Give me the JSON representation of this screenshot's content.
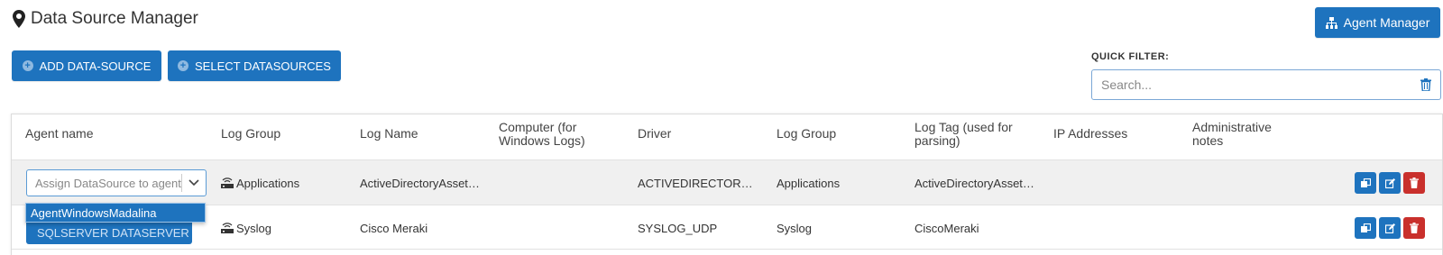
{
  "header": {
    "title": "Data Source Manager",
    "agent_manager_label": "Agent Manager"
  },
  "toolbar": {
    "add_label": "ADD DATA-SOURCE",
    "select_label": "SELECT DATASOURCES"
  },
  "filter": {
    "label": "QUICK FILTER:",
    "placeholder": "Search..."
  },
  "table": {
    "columns": [
      "Agent name",
      "Log Group",
      "Log Name",
      "Computer (for Windows Logs)",
      "Driver",
      "Log Group",
      "Log Tag (used for parsing)",
      "IP Addresses",
      "Administrative notes"
    ],
    "rows": [
      {
        "agent_placeholder": "Assign DataSource to agent",
        "log_group": "Applications",
        "log_name": "ActiveDirectoryAsset…",
        "computer": "",
        "driver": "ACTIVEDIRECTOR…",
        "log_group2": "Applications",
        "log_tag": "ActiveDirectoryAsset…",
        "ip": "",
        "notes": ""
      },
      {
        "agent_button": "SQLSERVER DATASERVER",
        "log_group": "Syslog",
        "log_name": "Cisco Meraki",
        "computer": "",
        "driver": "SYSLOG_UDP",
        "log_group2": "Syslog",
        "log_tag": "CiscoMeraki",
        "ip": "",
        "notes": ""
      }
    ]
  },
  "dropdown": {
    "option": "AgentWindowsMadalina"
  },
  "colors": {
    "primary": "#1e73be",
    "danger": "#c9302c",
    "row_alt": "#f0f0f0"
  },
  "icons": [
    "map-pin-icon",
    "sitemap-icon",
    "plus-circle-icon",
    "trash-icon",
    "network-icon",
    "chevron-down-icon",
    "copy-icon",
    "edit-icon"
  ]
}
